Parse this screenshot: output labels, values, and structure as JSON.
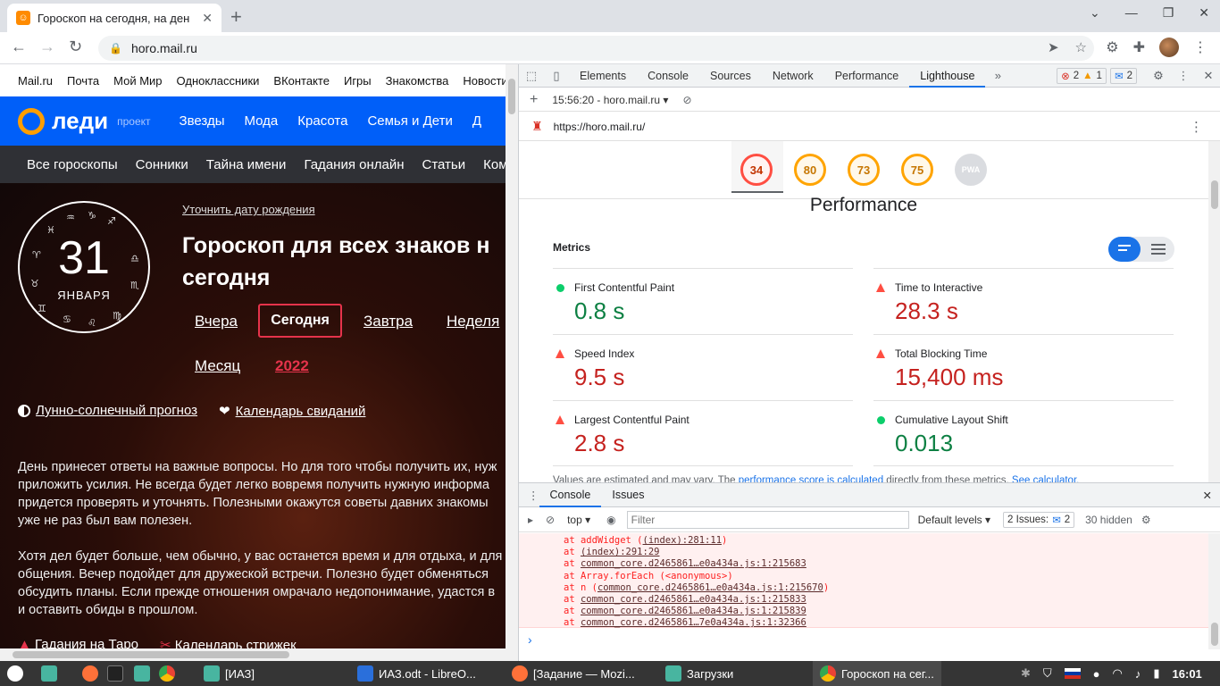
{
  "browser": {
    "tab_title": "Гороскоп на сегодня, на ден",
    "url": "horo.mail.ru"
  },
  "mailbar": [
    "Mail.ru",
    "Почта",
    "Мой Мир",
    "Одноклассники",
    "ВКонтакте",
    "Игры",
    "Знакомства",
    "Новости"
  ],
  "ledi": {
    "logo": "леди",
    "project": "проект",
    "links": [
      "Звезды",
      "Мода",
      "Красота",
      "Семья и Дети",
      "Д"
    ]
  },
  "catbar": [
    "Все гороскопы",
    "Сонники",
    "Тайна имени",
    "Гадания онлайн",
    "Статьи",
    "Ком"
  ],
  "hero": {
    "day": "31",
    "month": "ЯНВАРЯ",
    "clarify": "Уточнить дату рождения",
    "title_line1": "Гороскоп для всех знаков н",
    "title_line2": "сегодня",
    "yesterday": "Вчера",
    "today": "Сегодня",
    "tomorrow": "Завтра",
    "week": "Неделя",
    "month_link": "Месяц",
    "year": "2022",
    "lunar": "Лунно-солнечный прогноз",
    "dates": "Календарь свиданий",
    "para1": [
      "День принесет ответы на важные вопросы. Но для того чтобы получить их, нуж",
      "приложить усилия. Не всегда будет легко вовремя получить нужную информа",
      "придется проверять и уточнять. Полезными окажутся советы давних знакомы",
      "уже не раз был вам полезен."
    ],
    "para2": [
      "Хотя дел будет больше, чем обычно, у вас останется время и для отдыха, и для",
      "общения. Вечер подойдет для дружеской встречи. Полезно будет обменяться",
      "обсудить планы. Если прежде отношения омрачало недопонимание, удастся в",
      "и оставить обиды в прошлом."
    ],
    "bottom": [
      "Гадания на Таро",
      "Календарь стрижек"
    ]
  },
  "devtools": {
    "tabs": [
      "Elements",
      "Console",
      "Sources",
      "Network",
      "Performance",
      "Lighthouse"
    ],
    "errors": "2",
    "warnings": "1",
    "messages": "2",
    "report": "15:56:20 - horo.mail.ru",
    "report_url": "https://horo.mail.ru/",
    "scores": [
      "34",
      "80",
      "73",
      "75",
      "PWA"
    ],
    "category": "Performance",
    "metrics_heading": "Metrics",
    "metrics": [
      {
        "name": "First Contentful Paint",
        "value": "0.8 s",
        "status": "pass"
      },
      {
        "name": "Time to Interactive",
        "value": "28.3 s",
        "status": "fail"
      },
      {
        "name": "Speed Index",
        "value": "9.5 s",
        "status": "fail"
      },
      {
        "name": "Total Blocking Time",
        "value": "15,400 ms",
        "status": "fail"
      },
      {
        "name": "Largest Contentful Paint",
        "value": "2.8 s",
        "status": "fail"
      },
      {
        "name": "Cumulative Layout Shift",
        "value": "0.013",
        "status": "pass"
      }
    ],
    "note_pre": "Values are estimated and may vary. The ",
    "note_link": "performance score is calculated",
    "note_mid": " directly from these metrics. ",
    "note_link2": "See calculator."
  },
  "console": {
    "tabs": [
      "Console",
      "Issues"
    ],
    "context": "top",
    "filter_placeholder": "Filter",
    "levels": "Default levels",
    "issues": "2 Issues:",
    "issues_count": "2",
    "hidden": "30 hidden",
    "lines": [
      {
        "pre": "at addWidget (",
        "link": "(index):281:11",
        "post": ")"
      },
      {
        "pre": "at ",
        "link": "(index):291:29",
        "post": ""
      },
      {
        "pre": "at ",
        "link": "common_core.d2465861…e0a434a.js:1:215683",
        "post": ""
      },
      {
        "pre": "at Array.forEach (<anonymous>)",
        "link": "",
        "post": ""
      },
      {
        "pre": "at n (",
        "link": "common_core.d2465861…e0a434a.js:1:215670",
        "post": ")"
      },
      {
        "pre": "at ",
        "link": "common_core.d2465861…e0a434a.js:1:215833",
        "post": ""
      },
      {
        "pre": "at ",
        "link": "common_core.d2465861…e0a434a.js:1:215839",
        "post": ""
      },
      {
        "pre": "at ",
        "link": "common_core.d2465861…7e0a434a.js:1:32366",
        "post": ""
      }
    ]
  },
  "taskbar": {
    "items": [
      "[ИАЗ]",
      "ИАЗ.odt - LibreO...",
      "[Задание — Mozi...",
      "Загрузки",
      "Гороскоп на сег..."
    ],
    "clock": "16:01"
  }
}
